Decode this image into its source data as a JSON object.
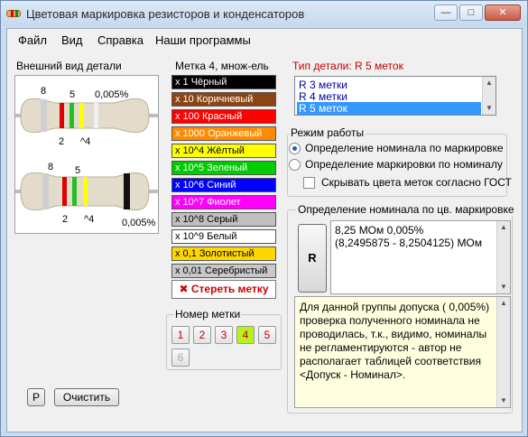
{
  "window": {
    "title": "Цветовая маркировка резисторов и конденсаторов",
    "controls": [
      "—",
      "□",
      "✕"
    ]
  },
  "menu": [
    "Файл",
    "Вид",
    "Справка",
    "Наши программы"
  ],
  "appearance": {
    "label": "Внешний вид детали",
    "resistor1": {
      "band_labels": [
        "8",
        "5",
        "0,005%",
        "2",
        "^4"
      ]
    },
    "resistor2": {
      "band_labels": [
        "8",
        "5",
        "2",
        "^4",
        "0,005%"
      ]
    }
  },
  "colors_panel": {
    "title": "Метка 4, множ-ель",
    "buttons": [
      {
        "label": "x 1 Чёрный",
        "bg": "#000000",
        "fg": "#ffffff"
      },
      {
        "label": "x 10 Коричневый",
        "bg": "#8b4513",
        "fg": "#ffffff"
      },
      {
        "label": "x 100 Красный",
        "bg": "#ff0000",
        "fg": "#ffffff"
      },
      {
        "label": "x 1000 Оранжевый",
        "bg": "#ff8c00",
        "fg": "#ffffff"
      },
      {
        "label": "x 10^4 Жёлтый",
        "bg": "#ffff00",
        "fg": "#000000"
      },
      {
        "label": "x 10^5 Зеленый",
        "bg": "#00cc00",
        "fg": "#ffffff"
      },
      {
        "label": "x 10^6 Синий",
        "bg": "#0000ff",
        "fg": "#ffffff"
      },
      {
        "label": "x 10^7 Фиолет",
        "bg": "#ff00ff",
        "fg": "#ffffff"
      },
      {
        "label": "x 10^8 Серый",
        "bg": "#c0c0c0",
        "fg": "#000000"
      },
      {
        "label": "x 10^9 Белый",
        "bg": "#ffffff",
        "fg": "#000000"
      },
      {
        "label": "x 0,1 Золотистый",
        "bg": "#ffd700",
        "fg": "#000000"
      },
      {
        "label": "x 0,01 Серебристый",
        "bg": "#c8c8c8",
        "fg": "#000000"
      }
    ],
    "erase_label": "Стереть метку"
  },
  "band_numbers": {
    "label": "Номер метки",
    "buttons": [
      "1",
      "2",
      "3",
      "4",
      "5",
      "6"
    ],
    "selected": "4"
  },
  "bottom_buttons": {
    "r_label": "P",
    "clear_label": "Очистить"
  },
  "part_type": {
    "label": "Тип детали: R 5 меток",
    "options": [
      "R 3 метки",
      "R 4 метки",
      "R 5 меток"
    ],
    "selected": "R 5 меток"
  },
  "mode": {
    "label": "Режим работы",
    "options": [
      "Определение номинала по маркировке",
      "Определение маркировки по номиналу"
    ],
    "selected": 0,
    "hide_gost_label": "Скрывать цвета меток согласно ГОСТ",
    "hide_gost_checked": false
  },
  "result": {
    "label": "Определение номинала по цв. маркировке",
    "button_label": "R",
    "line1": "8,25 МОм  0,005%",
    "line2": "(8,2495875 - 8,2504125) МОм",
    "note": "Для данной группы допуска ( 0,005%) проверка полученного номинала не проводилась, т.к., видимо, номиналы не регламентируются - автор не располагает таблицей соответствия <Допуск - Номинал>."
  }
}
